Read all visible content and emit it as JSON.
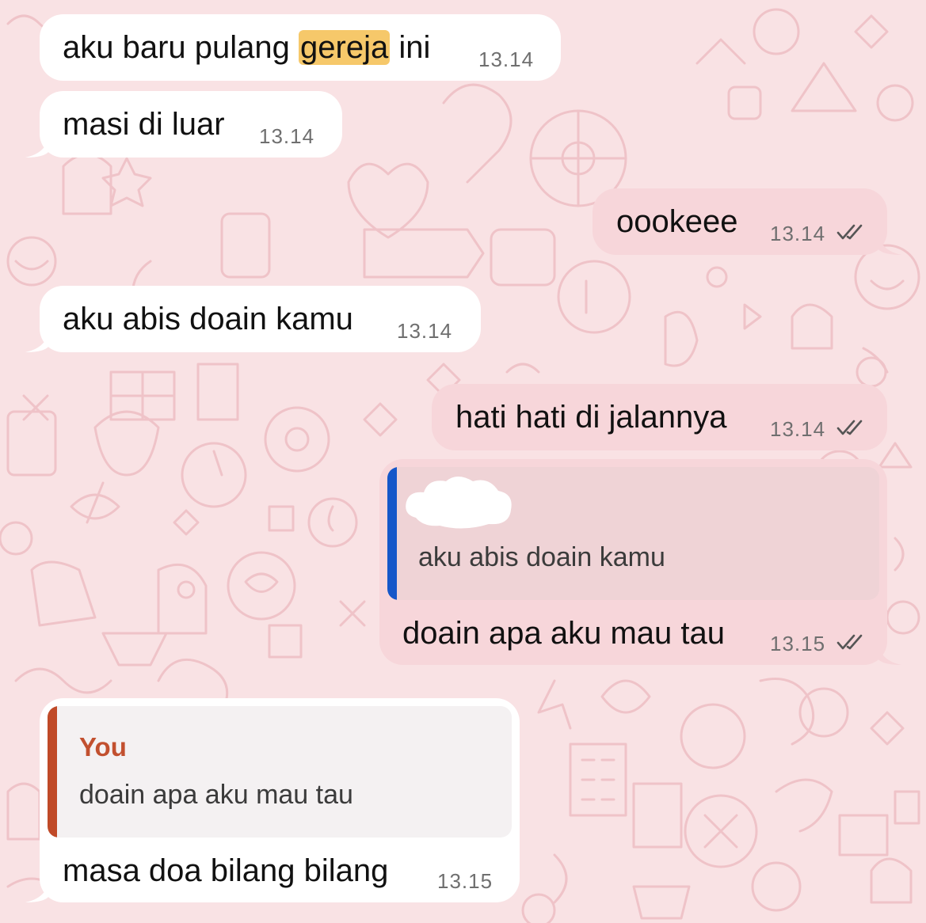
{
  "colors": {
    "background": "#f9e2e4",
    "incoming_bubble": "#ffffff",
    "outgoing_bubble": "#f7d6da",
    "highlight": "#f6c86a",
    "quote_bar_blue": "#1557c9",
    "quote_bar_orange": "#c04a28",
    "quote_name": "#c2502f",
    "read_ticks": "#555555"
  },
  "messages": [
    {
      "direction": "incoming",
      "text_before": "aku baru pulang ",
      "highlight": "gereja",
      "text_after": " ini",
      "time": "13.14"
    },
    {
      "direction": "incoming",
      "text": "masi di luar",
      "time": "13.14"
    },
    {
      "direction": "outgoing",
      "text": "oookeee",
      "time": "13.14",
      "status_icon": "double-check-icon"
    },
    {
      "direction": "incoming",
      "text": "aku abis doain kamu",
      "time": "13.14"
    },
    {
      "direction": "outgoing",
      "text": "hati hati di jalannya",
      "time": "13.14",
      "status_icon": "double-check-icon"
    },
    {
      "direction": "outgoing",
      "quote": {
        "author": "",
        "text": "aku abis doain kamu"
      },
      "text": "doain apa aku mau tau",
      "time": "13.15",
      "status_icon": "double-check-icon"
    },
    {
      "direction": "incoming",
      "quote": {
        "author": "You",
        "text": "doain apa aku mau tau"
      },
      "text": "masa doa bilang bilang",
      "time": "13.15"
    }
  ]
}
